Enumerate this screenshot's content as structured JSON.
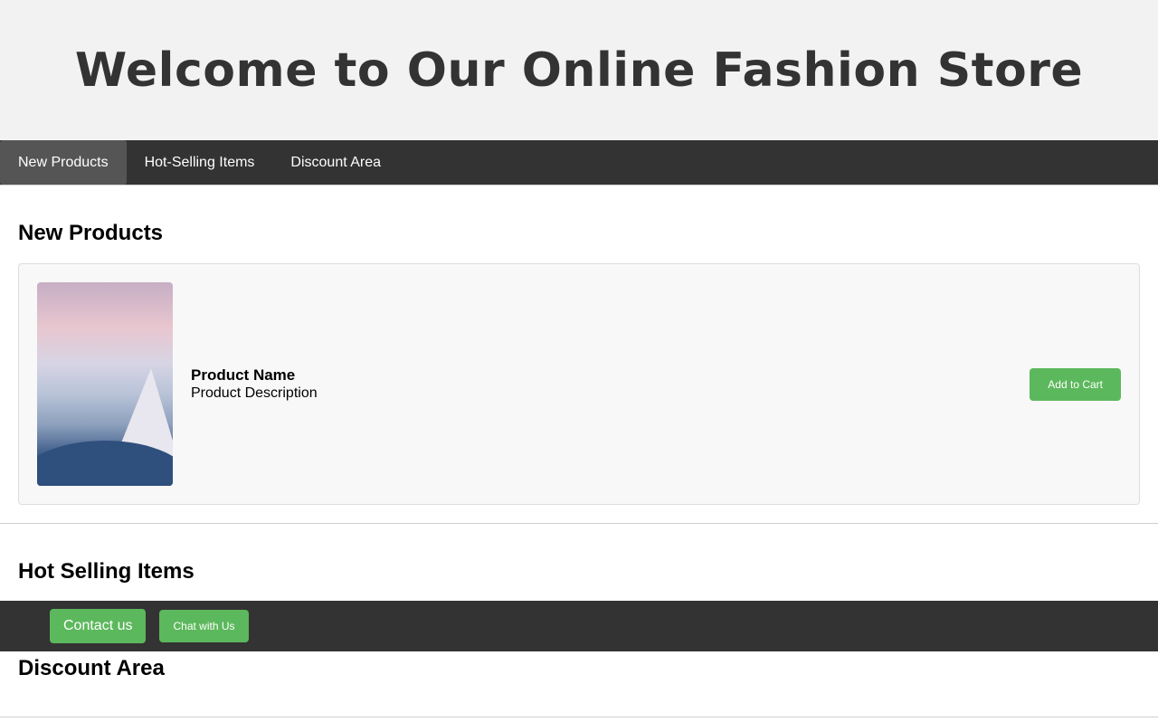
{
  "header": {
    "title": "Welcome to Our Online Fashion Store"
  },
  "nav": {
    "items": [
      {
        "label": "New Products",
        "active": true
      },
      {
        "label": "Hot-Selling Items",
        "active": false
      },
      {
        "label": "Discount Area",
        "active": false
      }
    ]
  },
  "sections": {
    "new_products": {
      "title": "New Products",
      "product": {
        "image": "mountain-sky-image",
        "name": "Product Name",
        "description": "Product Description",
        "cta": "Add to Cart"
      }
    },
    "hot_selling": {
      "title": "Hot Selling Items"
    },
    "discount": {
      "title": "Discount Area"
    }
  },
  "footer": {
    "contact_label": "Contact us",
    "chat_label": "Chat with Us"
  },
  "colors": {
    "nav_bg": "#333333",
    "active_tab": "#555555",
    "accent_green": "#5cb85c",
    "hero_bg": "#f2f2f2"
  }
}
